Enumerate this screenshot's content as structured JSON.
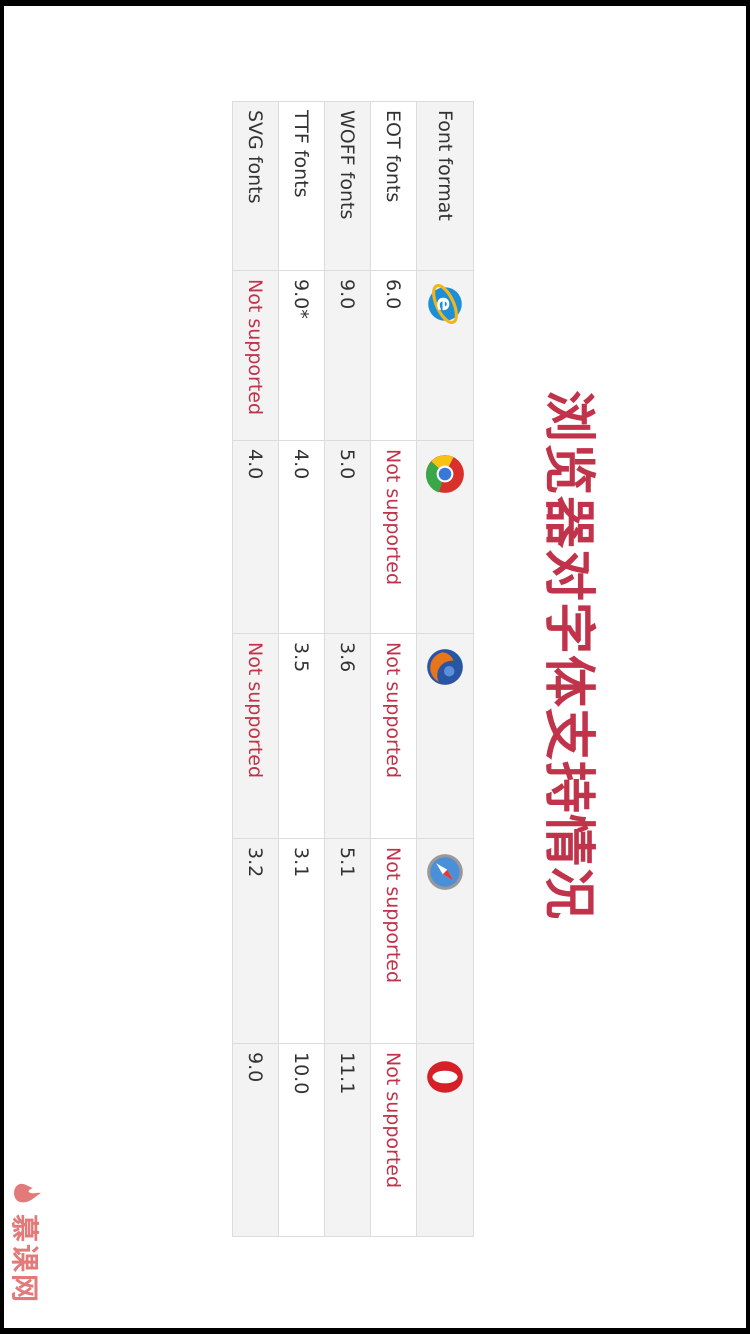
{
  "title": "浏览器对字体支持情况",
  "table": {
    "header_first": "Font format",
    "browser_icons": [
      "ie-icon",
      "chrome-icon",
      "firefox-icon",
      "safari-icon",
      "opera-icon"
    ],
    "rows": [
      {
        "label": "EOT fonts",
        "cells": [
          "6.0",
          "Not supported",
          "Not supported",
          "Not supported",
          "Not supported"
        ]
      },
      {
        "label": "WOFF fonts",
        "cells": [
          "9.0",
          "5.0",
          "3.6",
          "5.1",
          "11.1"
        ]
      },
      {
        "label": "TTF fonts",
        "cells": [
          "9.0*",
          "4.0",
          "3.5",
          "3.1",
          "10.0"
        ]
      },
      {
        "label": "SVG fonts",
        "cells": [
          "Not supported",
          "4.0",
          "Not supported",
          "3.2",
          "9.0"
        ]
      }
    ]
  },
  "logo": {
    "text": "慕课网",
    "icon": "flame-icon"
  },
  "colors": {
    "accent": "#c0334a",
    "border": "#dcdcdc",
    "stripe": "#f3f3f3"
  }
}
